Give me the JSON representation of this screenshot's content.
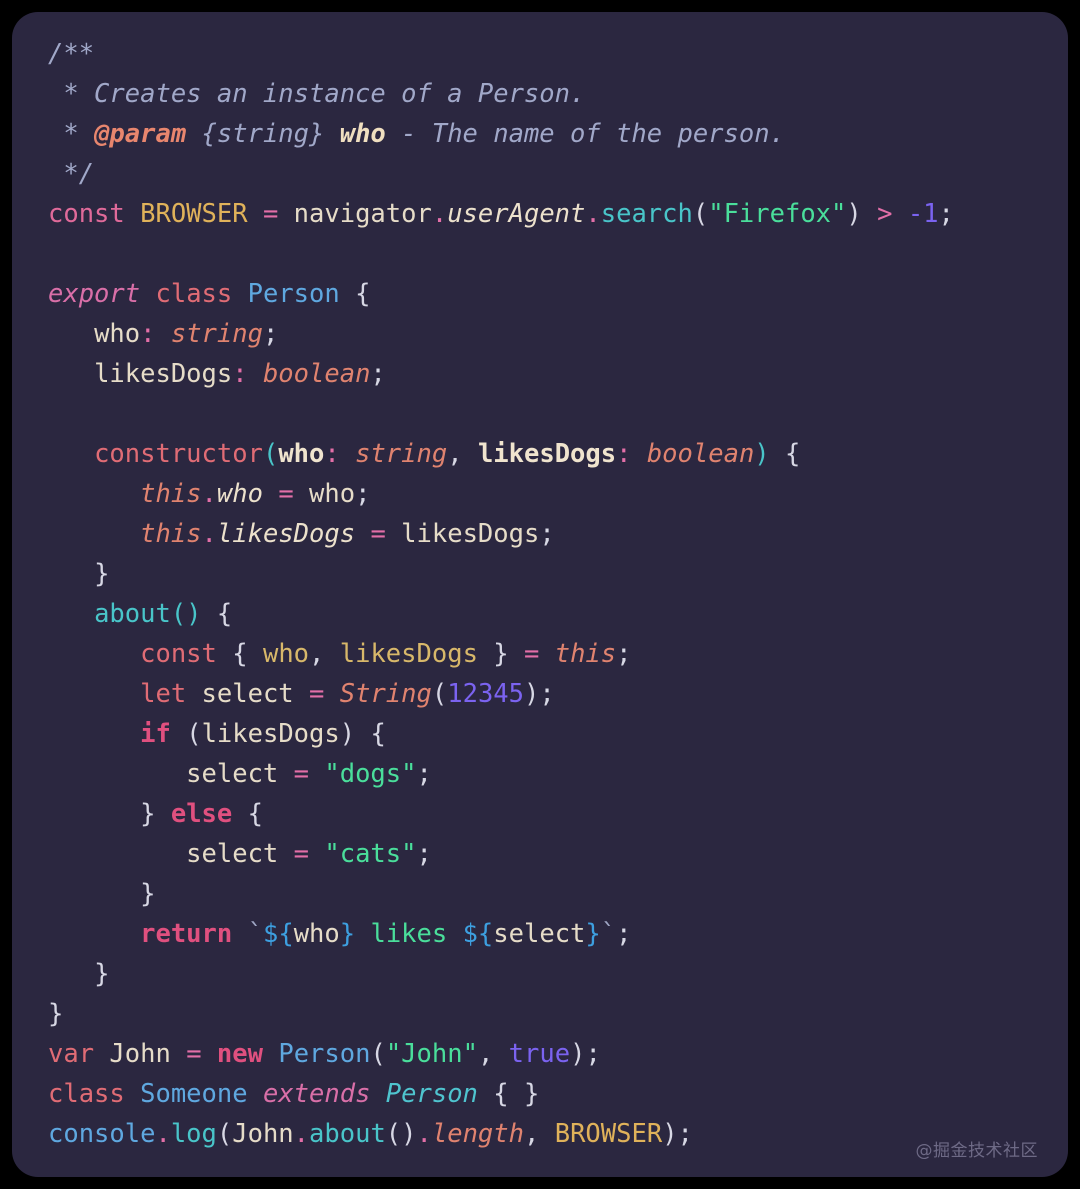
{
  "card": {
    "background": "#2b2740",
    "outer_background": "#000000",
    "language": "typescript",
    "watermark": "@掘金技术社区"
  },
  "theme": {
    "comment": "#a1a8c9",
    "keyword": "#e06c75",
    "keyword_bold": "#e0507f",
    "constant": "#e0b25a",
    "variable": "#e6dcc8",
    "type": "#e0836f",
    "class": "#5fa8e0",
    "function": "#49c5c9",
    "string": "#4ade9b",
    "number": "#7b63f0",
    "operator": "#e36fa8",
    "punctuation": "#d7d7e4",
    "template": "#3d9fe0"
  },
  "code": {
    "lines": [
      {
        "n": 1,
        "text": "/**"
      },
      {
        "n": 2,
        "text": " * Creates an instance of a Person."
      },
      {
        "n": 3,
        "text": " * @param {string} who - The name of the person."
      },
      {
        "n": 4,
        "text": " */"
      },
      {
        "n": 5,
        "text": "const BROWSER = navigator.userAgent.search(\"Firefox\") > -1;"
      },
      {
        "n": 6,
        "text": ""
      },
      {
        "n": 7,
        "text": "export class Person {"
      },
      {
        "n": 8,
        "text": "   who: string;"
      },
      {
        "n": 9,
        "text": "   likesDogs: boolean;"
      },
      {
        "n": 10,
        "text": ""
      },
      {
        "n": 11,
        "text": "   constructor(who: string, likesDogs: boolean) {"
      },
      {
        "n": 12,
        "text": "      this.who = who;"
      },
      {
        "n": 13,
        "text": "      this.likesDogs = likesDogs;"
      },
      {
        "n": 14,
        "text": "   }"
      },
      {
        "n": 15,
        "text": "   about() {"
      },
      {
        "n": 16,
        "text": "      const { who, likesDogs } = this;"
      },
      {
        "n": 17,
        "text": "      let select = String(12345);"
      },
      {
        "n": 18,
        "text": "      if (likesDogs) {"
      },
      {
        "n": 19,
        "text": "         select = \"dogs\";"
      },
      {
        "n": 20,
        "text": "      } else {"
      },
      {
        "n": 21,
        "text": "         select = \"cats\";"
      },
      {
        "n": 22,
        "text": "      }"
      },
      {
        "n": 23,
        "text": "      return `${who} likes ${select}`;"
      },
      {
        "n": 24,
        "text": "   }"
      },
      {
        "n": 25,
        "text": "}"
      },
      {
        "n": 26,
        "text": "var John = new Person(\"John\", true);"
      },
      {
        "n": 27,
        "text": "class Someone extends Person { }"
      },
      {
        "n": 28,
        "text": "console.log(John.about().length, BROWSER);"
      }
    ],
    "tokens": [
      [
        {
          "c": "t-comment",
          "t": "/**"
        }
      ],
      [
        {
          "c": "t-comment",
          "t": " * Creates an instance of a Person."
        }
      ],
      [
        {
          "c": "t-comment",
          "t": " * "
        },
        {
          "c": "t-comment-b",
          "t": "@param"
        },
        {
          "c": "t-comment",
          "t": " {string} "
        },
        {
          "c": "t-comment-p",
          "t": "who"
        },
        {
          "c": "t-comment",
          "t": " - The name of the person."
        }
      ],
      [
        {
          "c": "t-comment",
          "t": " */"
        }
      ],
      [
        {
          "c": "t-kwpink",
          "t": "const"
        },
        {
          "c": "t-var",
          "t": " "
        },
        {
          "c": "t-const",
          "t": "BROWSER"
        },
        {
          "c": "t-var",
          "t": " "
        },
        {
          "c": "t-op",
          "t": "="
        },
        {
          "c": "t-var",
          "t": " "
        },
        {
          "c": "t-var",
          "t": "navigator"
        },
        {
          "c": "t-op",
          "t": "."
        },
        {
          "c": "t-var-i",
          "t": "userAgent"
        },
        {
          "c": "t-op",
          "t": "."
        },
        {
          "c": "t-fn",
          "t": "search"
        },
        {
          "c": "t-punc",
          "t": "("
        },
        {
          "c": "t-str",
          "t": "\"Firefox\""
        },
        {
          "c": "t-punc",
          "t": ")"
        },
        {
          "c": "t-var",
          "t": " "
        },
        {
          "c": "t-op",
          "t": ">"
        },
        {
          "c": "t-var",
          "t": " "
        },
        {
          "c": "t-num",
          "t": "-1"
        },
        {
          "c": "t-punc",
          "t": ";"
        }
      ],
      [
        {
          "c": "t-var",
          "t": ""
        }
      ],
      [
        {
          "c": "t-kw-i",
          "t": "export"
        },
        {
          "c": "t-var",
          "t": " "
        },
        {
          "c": "t-kw",
          "t": "class"
        },
        {
          "c": "t-var",
          "t": " "
        },
        {
          "c": "t-class",
          "t": "Person"
        },
        {
          "c": "t-var",
          "t": " "
        },
        {
          "c": "t-punc",
          "t": "{"
        }
      ],
      [
        {
          "c": "t-var",
          "t": "   "
        },
        {
          "c": "t-var",
          "t": "who"
        },
        {
          "c": "t-op",
          "t": ":"
        },
        {
          "c": "t-var",
          "t": " "
        },
        {
          "c": "t-type",
          "t": "string"
        },
        {
          "c": "t-punc",
          "t": ";"
        }
      ],
      [
        {
          "c": "t-var",
          "t": "   "
        },
        {
          "c": "t-var",
          "t": "likesDogs"
        },
        {
          "c": "t-op",
          "t": ":"
        },
        {
          "c": "t-var",
          "t": " "
        },
        {
          "c": "t-type",
          "t": "boolean"
        },
        {
          "c": "t-punc",
          "t": ";"
        }
      ],
      [
        {
          "c": "t-var",
          "t": ""
        }
      ],
      [
        {
          "c": "t-var",
          "t": "   "
        },
        {
          "c": "t-kw",
          "t": "constructor"
        },
        {
          "c": "t-fn",
          "t": "("
        },
        {
          "c": "t-var-b",
          "t": "who"
        },
        {
          "c": "t-op",
          "t": ":"
        },
        {
          "c": "t-var",
          "t": " "
        },
        {
          "c": "t-type",
          "t": "string"
        },
        {
          "c": "t-punc",
          "t": ","
        },
        {
          "c": "t-var",
          "t": " "
        },
        {
          "c": "t-var-b",
          "t": "likesDogs"
        },
        {
          "c": "t-op",
          "t": ":"
        },
        {
          "c": "t-var",
          "t": " "
        },
        {
          "c": "t-type",
          "t": "boolean"
        },
        {
          "c": "t-fn",
          "t": ")"
        },
        {
          "c": "t-var",
          "t": " "
        },
        {
          "c": "t-punc",
          "t": "{"
        }
      ],
      [
        {
          "c": "t-var",
          "t": "      "
        },
        {
          "c": "t-type",
          "t": "this"
        },
        {
          "c": "t-op",
          "t": "."
        },
        {
          "c": "t-var-i",
          "t": "who"
        },
        {
          "c": "t-var",
          "t": " "
        },
        {
          "c": "t-op",
          "t": "="
        },
        {
          "c": "t-var",
          "t": " "
        },
        {
          "c": "t-var",
          "t": "who"
        },
        {
          "c": "t-punc",
          "t": ";"
        }
      ],
      [
        {
          "c": "t-var",
          "t": "      "
        },
        {
          "c": "t-type",
          "t": "this"
        },
        {
          "c": "t-op",
          "t": "."
        },
        {
          "c": "t-var-i",
          "t": "likesDogs"
        },
        {
          "c": "t-var",
          "t": " "
        },
        {
          "c": "t-op",
          "t": "="
        },
        {
          "c": "t-var",
          "t": " "
        },
        {
          "c": "t-var",
          "t": "likesDogs"
        },
        {
          "c": "t-punc",
          "t": ";"
        }
      ],
      [
        {
          "c": "t-var",
          "t": "   "
        },
        {
          "c": "t-punc",
          "t": "}"
        }
      ],
      [
        {
          "c": "t-var",
          "t": "   "
        },
        {
          "c": "t-fn",
          "t": "about"
        },
        {
          "c": "t-fn",
          "t": "()"
        },
        {
          "c": "t-var",
          "t": " "
        },
        {
          "c": "t-punc",
          "t": "{"
        }
      ],
      [
        {
          "c": "t-var",
          "t": "      "
        },
        {
          "c": "t-kw",
          "t": "const"
        },
        {
          "c": "t-var",
          "t": " "
        },
        {
          "c": "t-punc",
          "t": "{"
        },
        {
          "c": "t-var",
          "t": " "
        },
        {
          "c": "t-prop",
          "t": "who"
        },
        {
          "c": "t-punc",
          "t": ","
        },
        {
          "c": "t-var",
          "t": " "
        },
        {
          "c": "t-prop",
          "t": "likesDogs"
        },
        {
          "c": "t-var",
          "t": " "
        },
        {
          "c": "t-punc",
          "t": "}"
        },
        {
          "c": "t-var",
          "t": " "
        },
        {
          "c": "t-op",
          "t": "="
        },
        {
          "c": "t-var",
          "t": " "
        },
        {
          "c": "t-type",
          "t": "this"
        },
        {
          "c": "t-punc",
          "t": ";"
        }
      ],
      [
        {
          "c": "t-var",
          "t": "      "
        },
        {
          "c": "t-kw",
          "t": "let"
        },
        {
          "c": "t-var",
          "t": " "
        },
        {
          "c": "t-var",
          "t": "select"
        },
        {
          "c": "t-var",
          "t": " "
        },
        {
          "c": "t-op",
          "t": "="
        },
        {
          "c": "t-var",
          "t": " "
        },
        {
          "c": "t-type",
          "t": "String"
        },
        {
          "c": "t-punc",
          "t": "("
        },
        {
          "c": "t-num",
          "t": "12345"
        },
        {
          "c": "t-punc",
          "t": ")"
        },
        {
          "c": "t-punc",
          "t": ";"
        }
      ],
      [
        {
          "c": "t-var",
          "t": "      "
        },
        {
          "c": "t-kw-b",
          "t": "if"
        },
        {
          "c": "t-var",
          "t": " "
        },
        {
          "c": "t-punc",
          "t": "("
        },
        {
          "c": "t-var",
          "t": "likesDogs"
        },
        {
          "c": "t-punc",
          "t": ")"
        },
        {
          "c": "t-var",
          "t": " "
        },
        {
          "c": "t-punc",
          "t": "{"
        }
      ],
      [
        {
          "c": "t-var",
          "t": "         "
        },
        {
          "c": "t-var",
          "t": "select"
        },
        {
          "c": "t-var",
          "t": " "
        },
        {
          "c": "t-op",
          "t": "="
        },
        {
          "c": "t-var",
          "t": " "
        },
        {
          "c": "t-str",
          "t": "\"dogs\""
        },
        {
          "c": "t-punc",
          "t": ";"
        }
      ],
      [
        {
          "c": "t-var",
          "t": "      "
        },
        {
          "c": "t-punc",
          "t": "}"
        },
        {
          "c": "t-var",
          "t": " "
        },
        {
          "c": "t-kw-b",
          "t": "else"
        },
        {
          "c": "t-var",
          "t": " "
        },
        {
          "c": "t-punc",
          "t": "{"
        }
      ],
      [
        {
          "c": "t-var",
          "t": "         "
        },
        {
          "c": "t-var",
          "t": "select"
        },
        {
          "c": "t-var",
          "t": " "
        },
        {
          "c": "t-op",
          "t": "="
        },
        {
          "c": "t-var",
          "t": " "
        },
        {
          "c": "t-str",
          "t": "\"cats\""
        },
        {
          "c": "t-punc",
          "t": ";"
        }
      ],
      [
        {
          "c": "t-var",
          "t": "      "
        },
        {
          "c": "t-punc",
          "t": "}"
        }
      ],
      [
        {
          "c": "t-var",
          "t": "      "
        },
        {
          "c": "t-kw-b",
          "t": "return"
        },
        {
          "c": "t-var",
          "t": " "
        },
        {
          "c": "t-tick",
          "t": "`"
        },
        {
          "c": "t-tpl",
          "t": "${"
        },
        {
          "c": "t-var",
          "t": "who"
        },
        {
          "c": "t-tpl",
          "t": "}"
        },
        {
          "c": "t-str",
          "t": " likes "
        },
        {
          "c": "t-tpl",
          "t": "${"
        },
        {
          "c": "t-var",
          "t": "select"
        },
        {
          "c": "t-tpl",
          "t": "}"
        },
        {
          "c": "t-tick",
          "t": "`"
        },
        {
          "c": "t-punc",
          "t": ";"
        }
      ],
      [
        {
          "c": "t-var",
          "t": "   "
        },
        {
          "c": "t-punc",
          "t": "}"
        }
      ],
      [
        {
          "c": "t-punc",
          "t": "}"
        }
      ],
      [
        {
          "c": "t-kw",
          "t": "var"
        },
        {
          "c": "t-var",
          "t": " "
        },
        {
          "c": "t-var",
          "t": "John"
        },
        {
          "c": "t-var",
          "t": " "
        },
        {
          "c": "t-op",
          "t": "="
        },
        {
          "c": "t-var",
          "t": " "
        },
        {
          "c": "t-kw-b",
          "t": "new"
        },
        {
          "c": "t-var",
          "t": " "
        },
        {
          "c": "t-class",
          "t": "Person"
        },
        {
          "c": "t-punc",
          "t": "("
        },
        {
          "c": "t-str",
          "t": "\"John\""
        },
        {
          "c": "t-punc",
          "t": ","
        },
        {
          "c": "t-var",
          "t": " "
        },
        {
          "c": "t-num",
          "t": "true"
        },
        {
          "c": "t-punc",
          "t": ")"
        },
        {
          "c": "t-punc",
          "t": ";"
        }
      ],
      [
        {
          "c": "t-kw",
          "t": "class"
        },
        {
          "c": "t-var",
          "t": " "
        },
        {
          "c": "t-class",
          "t": "Someone"
        },
        {
          "c": "t-var",
          "t": " "
        },
        {
          "c": "t-kw-i",
          "t": "extends"
        },
        {
          "c": "t-var",
          "t": " "
        },
        {
          "c": "t-class-i",
          "t": "Person"
        },
        {
          "c": "t-var",
          "t": " "
        },
        {
          "c": "t-punc",
          "t": "{ }"
        }
      ],
      [
        {
          "c": "t-class",
          "t": "console"
        },
        {
          "c": "t-op",
          "t": "."
        },
        {
          "c": "t-fn",
          "t": "log"
        },
        {
          "c": "t-punc",
          "t": "("
        },
        {
          "c": "t-var",
          "t": "John"
        },
        {
          "c": "t-op",
          "t": "."
        },
        {
          "c": "t-fn",
          "t": "about"
        },
        {
          "c": "t-punc",
          "t": "()"
        },
        {
          "c": "t-op",
          "t": "."
        },
        {
          "c": "t-type",
          "t": "length"
        },
        {
          "c": "t-punc",
          "t": ","
        },
        {
          "c": "t-var",
          "t": " "
        },
        {
          "c": "t-const",
          "t": "BROWSER"
        },
        {
          "c": "t-punc",
          "t": ")"
        },
        {
          "c": "t-punc",
          "t": ";"
        }
      ]
    ]
  }
}
